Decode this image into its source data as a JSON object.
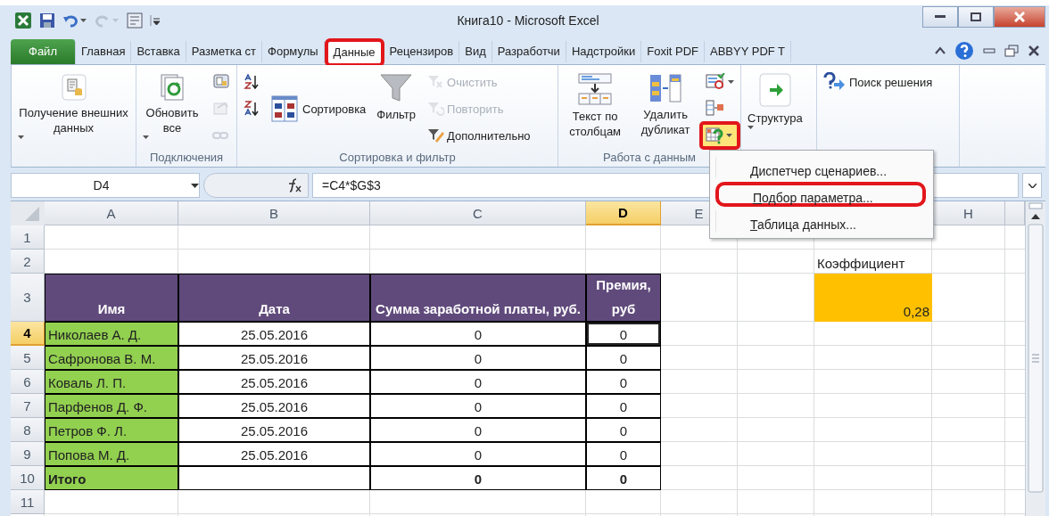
{
  "window": {
    "title": "Книга10 - Microsoft Excel"
  },
  "tabs": [
    {
      "label": "Файл",
      "kind": "file",
      "selected": false,
      "highlighted": false
    },
    {
      "label": "Главная",
      "kind": "tab",
      "selected": false,
      "highlighted": false
    },
    {
      "label": "Вставка",
      "kind": "tab",
      "selected": false,
      "highlighted": false
    },
    {
      "label": "Разметка ст",
      "kind": "tab",
      "selected": false,
      "highlighted": false
    },
    {
      "label": "Формулы",
      "kind": "tab",
      "selected": false,
      "highlighted": false
    },
    {
      "label": "Данные",
      "kind": "tab",
      "selected": true,
      "highlighted": true
    },
    {
      "label": "Рецензиров",
      "kind": "tab",
      "selected": false,
      "highlighted": false
    },
    {
      "label": "Вид",
      "kind": "tab",
      "selected": false,
      "highlighted": false
    },
    {
      "label": "Разработчи",
      "kind": "tab",
      "selected": false,
      "highlighted": false
    },
    {
      "label": "Надстройки",
      "kind": "tab",
      "selected": false,
      "highlighted": false
    },
    {
      "label": "Foxit PDF",
      "kind": "tab",
      "selected": false,
      "highlighted": false
    },
    {
      "label": "ABBYY PDF T",
      "kind": "tab",
      "selected": false,
      "highlighted": false
    }
  ],
  "ribbon": {
    "groups": [
      {
        "buttons": [
          {
            "kind": "large",
            "label": "Получение внешних данных",
            "dropdown": true
          }
        ]
      },
      {
        "label": "Подключения",
        "buttons": [
          {
            "kind": "large",
            "label": "Обновить все",
            "dropdown": true
          },
          {
            "kind": "icon",
            "disabled": false
          },
          {
            "kind": "icon",
            "disabled": true
          },
          {
            "kind": "icon",
            "disabled": true
          }
        ]
      },
      {
        "label": "Сортировка и фильтр",
        "buttons": [
          {
            "kind": "icon",
            "disabled": false
          },
          {
            "kind": "icon",
            "disabled": false
          },
          {
            "kind": "large",
            "label": "Сортировка",
            "dropdown": false
          },
          {
            "kind": "large",
            "label": "Фильтр",
            "dropdown": false
          },
          {
            "kind": "small",
            "label": "Очистить",
            "disabled": true
          },
          {
            "kind": "small",
            "label": "Повторить",
            "disabled": true
          },
          {
            "kind": "small",
            "label": "Дополнительно",
            "disabled": false
          }
        ]
      },
      {
        "label": "Работа с данным",
        "buttons": [
          {
            "kind": "large",
            "label": "Текст по столбцам",
            "dropdown": false
          },
          {
            "kind": "large",
            "label": "Удалить дубликат",
            "dropdown": false
          },
          {
            "kind": "icon",
            "disabled": false,
            "dropdown": true,
            "highlighted": false
          },
          {
            "kind": "icon",
            "disabled": false,
            "dropdown": false,
            "highlighted": false
          },
          {
            "kind": "icon",
            "disabled": false,
            "dropdown": true,
            "highlighted": true
          }
        ]
      },
      {
        "buttons": [
          {
            "kind": "large",
            "label": "Структура",
            "dropdown": true
          }
        ]
      },
      {
        "buttons": [
          {
            "kind": "small",
            "label": "Поиск решения",
            "disabled": false
          }
        ]
      }
    ]
  },
  "formula_bar": {
    "name_box": "D4",
    "formula": "=C4*$G$3"
  },
  "sheet": {
    "columns": [
      {
        "label": "A",
        "selected": false
      },
      {
        "label": "B",
        "selected": false
      },
      {
        "label": "C",
        "selected": false
      },
      {
        "label": "D",
        "selected": true
      },
      {
        "label": "E",
        "selected": false
      },
      {},
      {},
      {
        "label": "H",
        "selected": false
      }
    ],
    "row_headers": [
      {
        "label": "1",
        "selected": false
      },
      {
        "label": "2",
        "selected": false
      },
      {
        "label": "3",
        "selected": false
      },
      {
        "label": "4",
        "selected": true
      },
      {
        "label": "5",
        "selected": false
      },
      {
        "label": "6",
        "selected": false
      },
      {
        "label": "7",
        "selected": false
      },
      {
        "label": "8",
        "selected": false
      },
      {
        "label": "9",
        "selected": false
      },
      {
        "label": "10",
        "selected": false
      },
      {
        "label": "11",
        "selected": false
      }
    ],
    "table": {
      "columns": [
        "Имя",
        "Дата",
        "Сумма заработной платы, руб.",
        "Премия, руб"
      ],
      "rows": [
        {
          "name": "Николаев А. Д.",
          "date": "25.05.2016",
          "salary": "0",
          "bonus": "0",
          "active": true
        },
        {
          "name": "Сафронова В. М.",
          "date": "25.05.2016",
          "salary": "0",
          "bonus": "0",
          "active": false
        },
        {
          "name": "Коваль Л. П.",
          "date": "25.05.2016",
          "salary": "0",
          "bonus": "0",
          "active": false
        },
        {
          "name": "Парфенов Д. Ф.",
          "date": "25.05.2016",
          "salary": "0",
          "bonus": "0",
          "active": false
        },
        {
          "name": "Петров Ф. Л.",
          "date": "25.05.2016",
          "salary": "0",
          "bonus": "0",
          "active": false
        },
        {
          "name": "Попова М. Д.",
          "date": "25.05.2016",
          "salary": "0",
          "bonus": "0",
          "active": false
        }
      ],
      "total": {
        "name": "Итого",
        "salary": "0",
        "bonus": "0"
      }
    },
    "coefficient": {
      "label": "Коэффициент",
      "value": "0,28"
    }
  },
  "dropdown_menu": {
    "items": [
      {
        "label": "Диспетчер сценариев...",
        "highlighted": false
      },
      {
        "label": "Подбор параметра...",
        "highlighted": true
      },
      {
        "label": "Таблица данных...",
        "highlighted": false
      }
    ]
  }
}
